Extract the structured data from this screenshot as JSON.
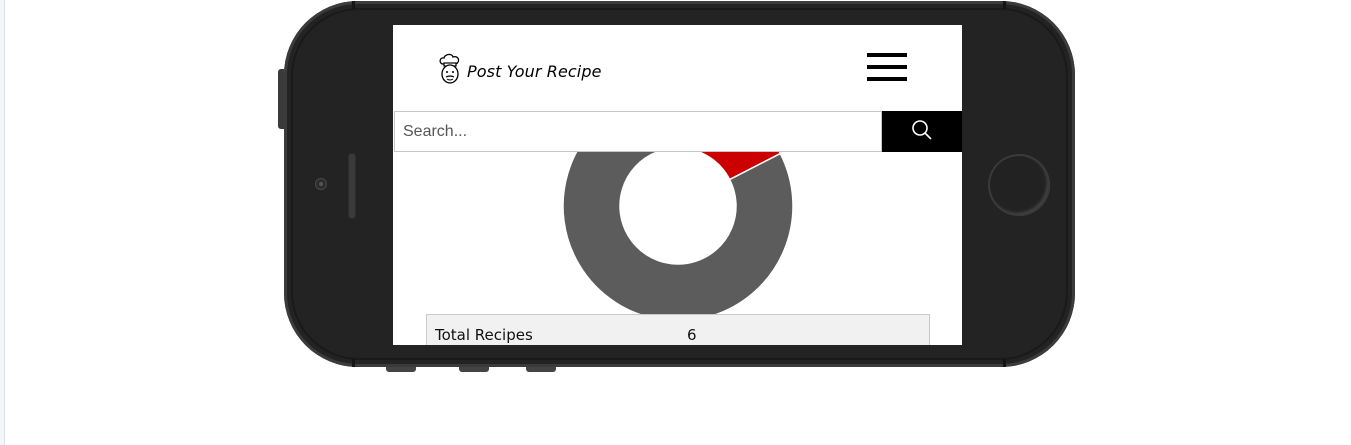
{
  "app": {
    "brand_name": "Post Your Recipe",
    "logo_icon": "chef-icon"
  },
  "navbar": {
    "menu_icon": "hamburger-menu-icon"
  },
  "search": {
    "placeholder": "Search...",
    "value": "",
    "button_icon": "search-icon"
  },
  "colors": {
    "accent": "#cc0000",
    "donut_primary": "#5c5c5c",
    "donut_secondary": "#cc0000",
    "search_button": "#000000",
    "device_body": "#232323"
  },
  "chart_data": {
    "type": "pie",
    "style": "donut",
    "slices": [
      {
        "value": 5,
        "color": "#5c5c5c"
      },
      {
        "value": 1,
        "color": "#cc0000"
      }
    ]
  },
  "stats": {
    "rows": [
      {
        "label": "Total Recipes",
        "value": "6"
      }
    ]
  }
}
